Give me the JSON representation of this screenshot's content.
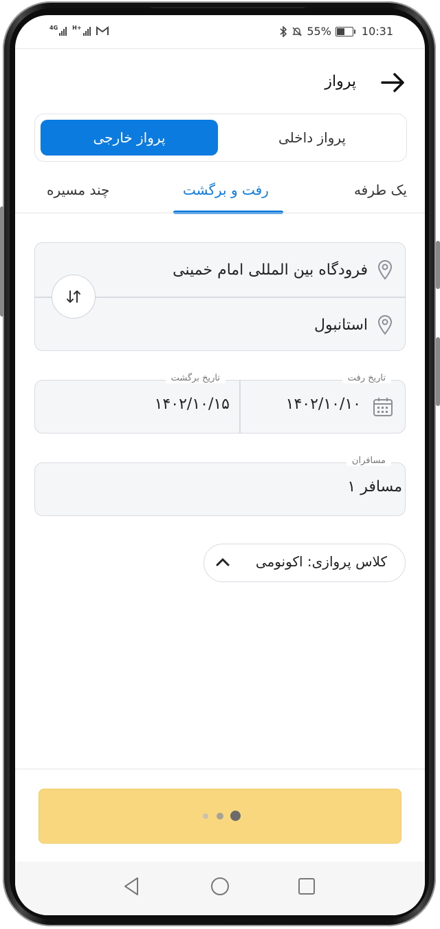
{
  "status_bar": {
    "network_1": "4G",
    "network_2": "H+",
    "battery_text": "55%",
    "battery_level": 0.55,
    "time": "10:31",
    "icons": [
      "signal-icon",
      "signal-icon",
      "gmail-icon",
      "bluetooth-icon",
      "mute-icon",
      "battery-icon"
    ]
  },
  "header": {
    "title": "پرواز",
    "back_icon": "arrow-right-icon"
  },
  "flight_type": {
    "international_label": "پرواز خارجی",
    "domestic_label": "پرواز داخلی",
    "selected": "international"
  },
  "trip_tabs": [
    {
      "label": "یک طرفه",
      "active": false
    },
    {
      "label": "رفت و برگشت",
      "active": true
    },
    {
      "label": "چند مسیره",
      "active": false
    }
  ],
  "route": {
    "origin": "فرودگاه بین المللی امام خمینی",
    "destination": "استانبول",
    "swap_icon": "swap-vertical-icon"
  },
  "dates": {
    "departure_label": "تاریخ رفت",
    "departure_value": "۱۴۰۲/۱۰/۱۰",
    "return_label": "تاریخ برگشت",
    "return_value": "۱۴۰۲/۱۰/۱۵"
  },
  "passengers": {
    "label": "مسافران",
    "value": "۱ مسافر"
  },
  "flight_class": {
    "text": "کلاس پروازی: اکونومی",
    "icon": "chevron-up-icon"
  },
  "search_button": {
    "state": "loading",
    "color": "#f8d77e"
  },
  "colors": {
    "accent": "#0b7be0",
    "cta": "#f8d77e"
  }
}
